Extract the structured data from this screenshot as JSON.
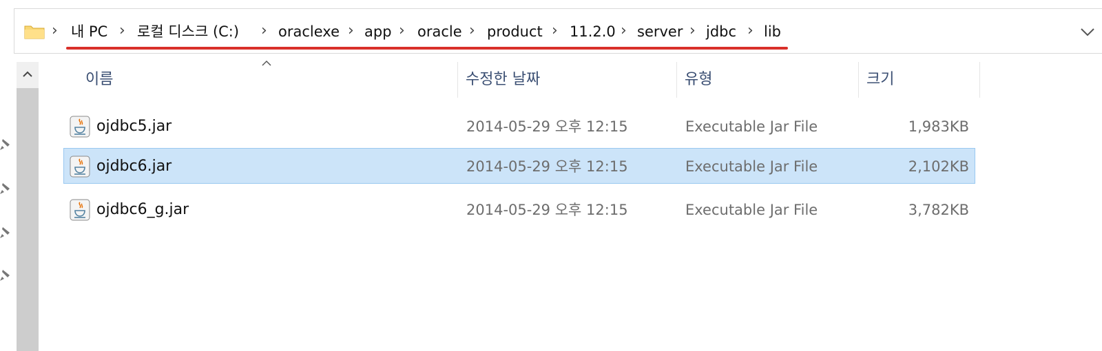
{
  "breadcrumb": {
    "folder_icon": "folder-icon",
    "items": [
      "내 PC",
      "로컬 디스크 (C:)",
      "oraclexe",
      "app",
      "oracle",
      "product",
      "11.2.0",
      "server",
      "jdbc",
      "lib"
    ],
    "separator": "›",
    "underline_color": "#d9302a"
  },
  "columns": {
    "name": "이름",
    "date": "수정한 날짜",
    "type": "유형",
    "size": "크기"
  },
  "files": [
    {
      "name": "ojdbc5.jar",
      "date": "2014-05-29 오후 12:15",
      "type": "Executable Jar File",
      "size": "1,983KB",
      "selected": false
    },
    {
      "name": "ojdbc6.jar",
      "date": "2014-05-29 오후 12:15",
      "type": "Executable Jar File",
      "size": "2,102KB",
      "selected": true
    },
    {
      "name": "ojdbc6_g.jar",
      "date": "2014-05-29 오후 12:15",
      "type": "Executable Jar File",
      "size": "3,782KB",
      "selected": false
    }
  ],
  "colors": {
    "selection_bg": "#cce4f9",
    "selection_border": "#99c8f0",
    "header_text": "#3b4f73"
  }
}
